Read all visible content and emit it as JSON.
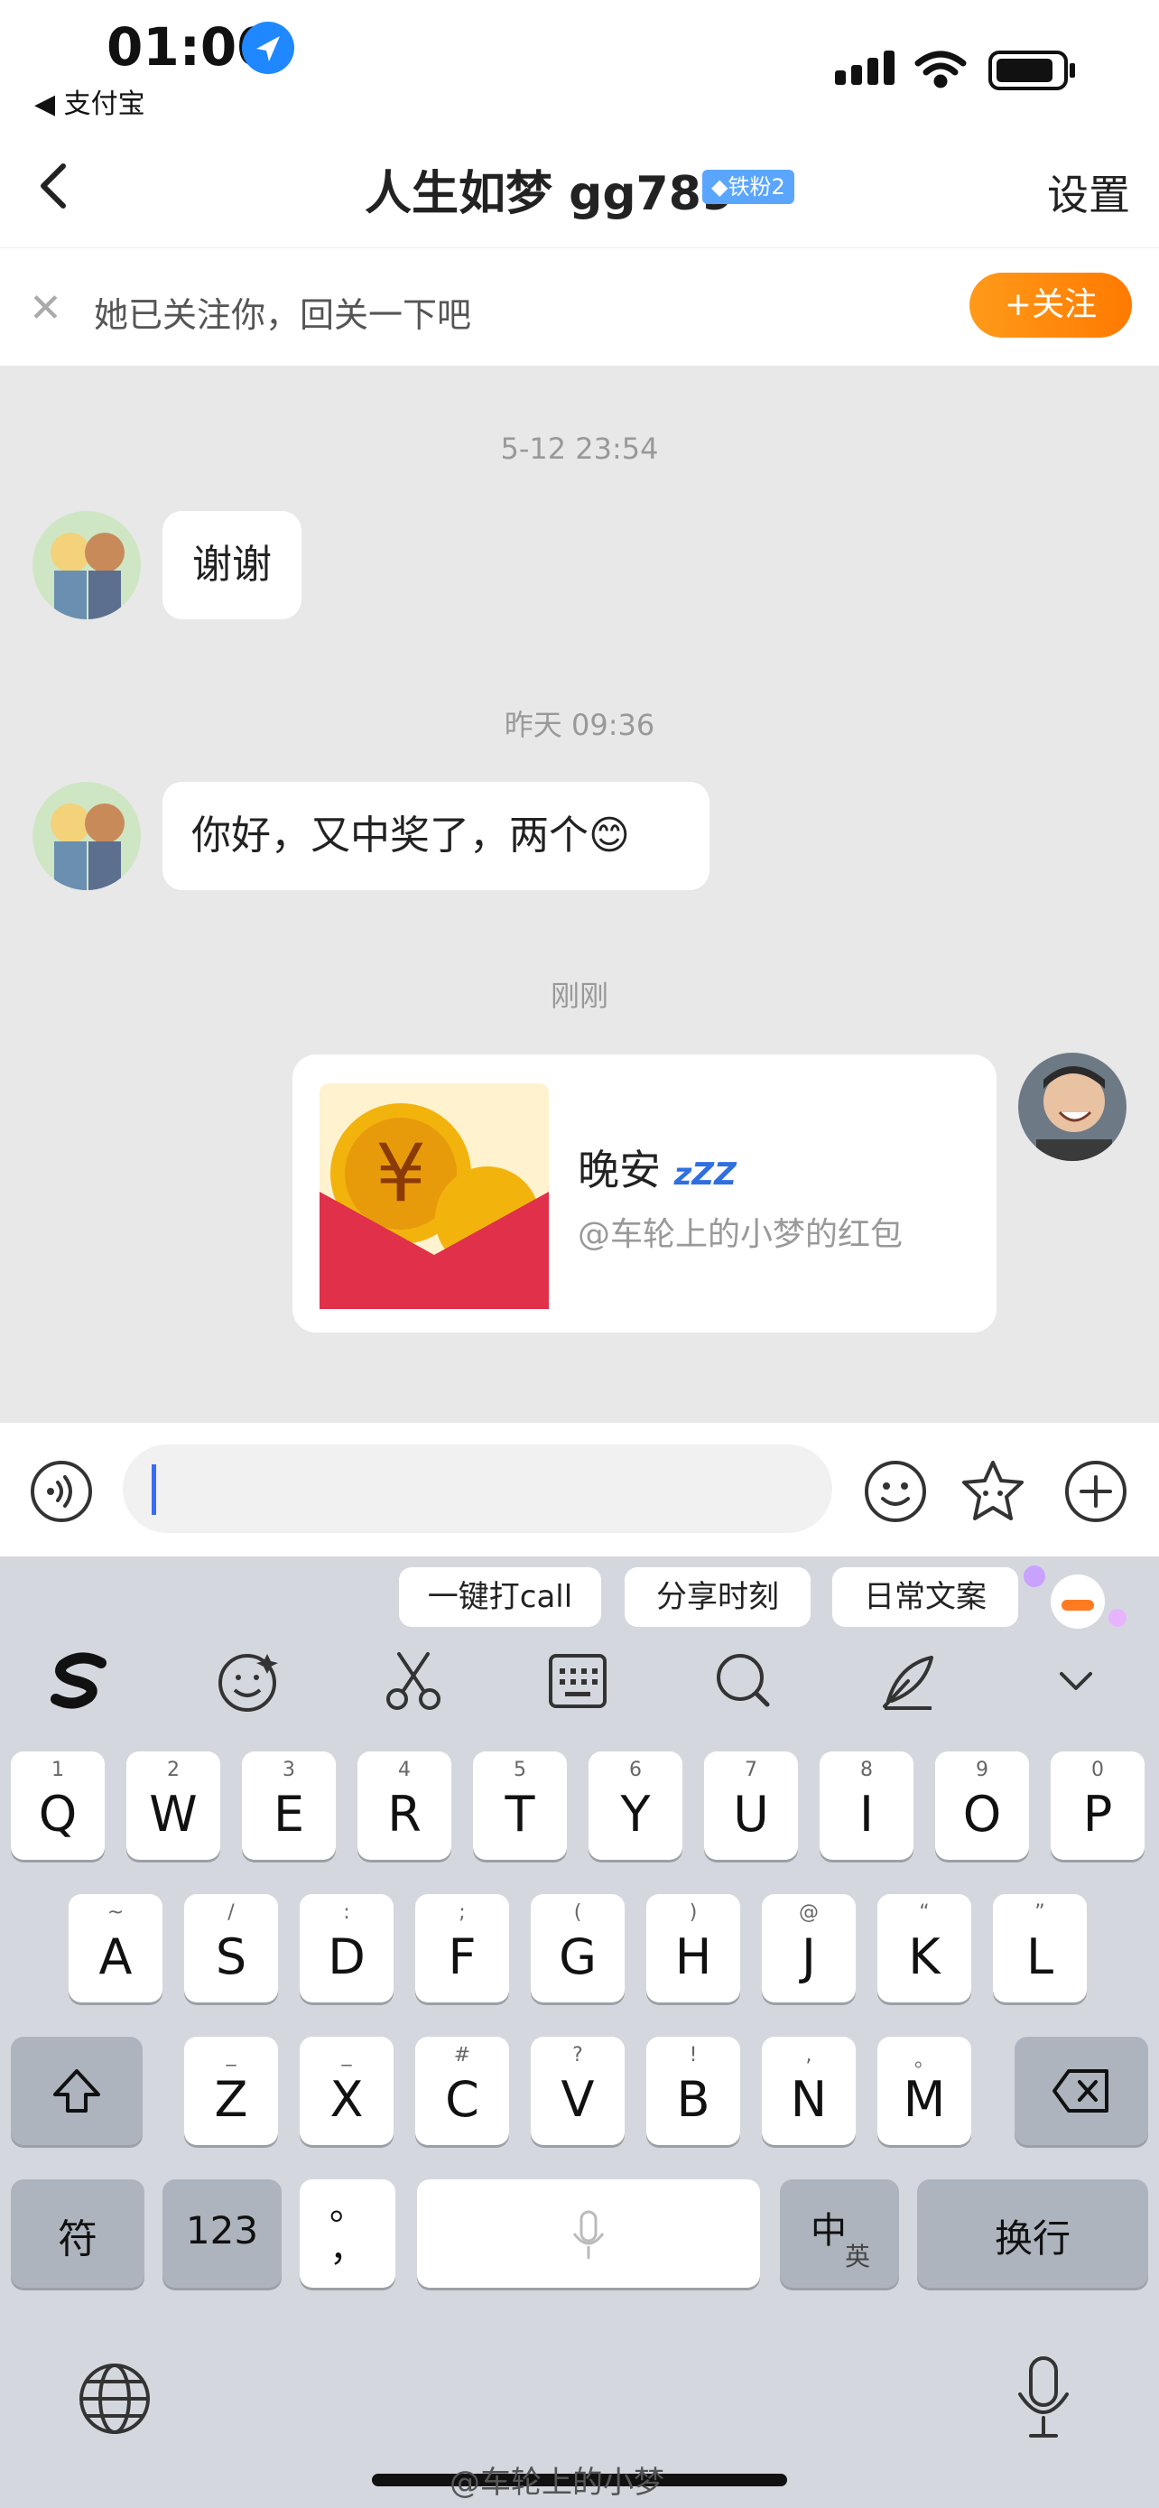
{
  "status_bar": {
    "time": "01:00",
    "back_app": "◀ 支付宝"
  },
  "nav": {
    "title": "人生如梦 gg789",
    "badge": "◆铁粉2",
    "settings": "设置"
  },
  "follow_bar": {
    "text": "她已关注你，回关一下吧",
    "button": "+关注"
  },
  "messages": [
    {
      "timestamp": "5-12 23:54",
      "text": "谢谢",
      "side": "left"
    },
    {
      "timestamp": "昨天 09:36",
      "text": "你好，又中奖了，两个😊",
      "side": "left"
    },
    {
      "timestamp": "刚刚",
      "side": "right",
      "red_packet": {
        "title": "晚安",
        "zz": "zZZ",
        "subtitle": "@车轮上的小梦的红包"
      }
    }
  ],
  "input": {
    "value": ""
  },
  "keyboard": {
    "suggestions": [
      "一键打call",
      "分享时刻",
      "日常文案"
    ],
    "row1": [
      {
        "k": "Q",
        "h": "1"
      },
      {
        "k": "W",
        "h": "2"
      },
      {
        "k": "E",
        "h": "3"
      },
      {
        "k": "R",
        "h": "4"
      },
      {
        "k": "T",
        "h": "5"
      },
      {
        "k": "Y",
        "h": "6"
      },
      {
        "k": "U",
        "h": "7"
      },
      {
        "k": "I",
        "h": "8"
      },
      {
        "k": "O",
        "h": "9"
      },
      {
        "k": "P",
        "h": "0"
      }
    ],
    "row2": [
      {
        "k": "A",
        "h": "~"
      },
      {
        "k": "S",
        "h": "/"
      },
      {
        "k": "D",
        "h": ":"
      },
      {
        "k": "F",
        "h": ";"
      },
      {
        "k": "G",
        "h": "("
      },
      {
        "k": "H",
        "h": ")"
      },
      {
        "k": "J",
        "h": "@"
      },
      {
        "k": "K",
        "h": "“"
      },
      {
        "k": "L",
        "h": "”"
      }
    ],
    "row3": [
      {
        "k": "Z",
        "h": "_"
      },
      {
        "k": "X",
        "h": "_"
      },
      {
        "k": "C",
        "h": "#"
      },
      {
        "k": "V",
        "h": "?"
      },
      {
        "k": "B",
        "h": "!"
      },
      {
        "k": "N",
        "h": ","
      },
      {
        "k": "M",
        "h": "。"
      }
    ],
    "fu": "符",
    "num": "123",
    "punct": "。\n，",
    "zh": "中",
    "en": "英",
    "enter": "换行"
  },
  "watermark": "@车轮上的小梦",
  "colors": {
    "accent_orange": "#ff8a00",
    "caret_blue": "#3a6df0",
    "fan_badge": "#5aa6ff",
    "red_packet": "#e0304a"
  }
}
